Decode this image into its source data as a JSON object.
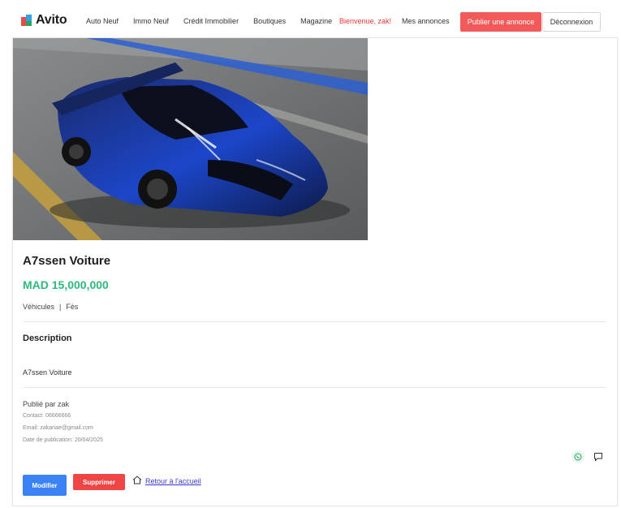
{
  "brand": {
    "name": "Avito"
  },
  "nav": {
    "links": [
      "Auto Neuf",
      "Immo Neuf",
      "Crédit Immobilier",
      "Boutiques",
      "Magazine"
    ],
    "welcome": "Bienvenue, zak!",
    "my_ads": "Mes annonces",
    "publish": "Publier une annonce",
    "logout": "Déconnexion"
  },
  "listing": {
    "title": "A7ssen Voiture",
    "price": "MAD 15,000,000",
    "category": "Véhicules",
    "separator": "|",
    "city": "Fès",
    "description_heading": "Description",
    "description": "A7ssen Voiture",
    "posted_by": "Publié par zak",
    "contact": "Contact: 06666666",
    "email": "Email: zakariae@gmail.com",
    "date": "Date de publication: 20/04/2025"
  },
  "actions": {
    "modify": "Modifier",
    "delete": "Supprimer",
    "back": "Retour à l'accueil"
  },
  "icons": {
    "whatsapp": "whatsapp-icon",
    "message": "message-icon",
    "home": "home-icon"
  },
  "colors": {
    "price": "#2db97d",
    "publish": "#f25a5a",
    "modify": "#3b82f6",
    "delete": "#f04545",
    "welcome": "#e53935"
  }
}
